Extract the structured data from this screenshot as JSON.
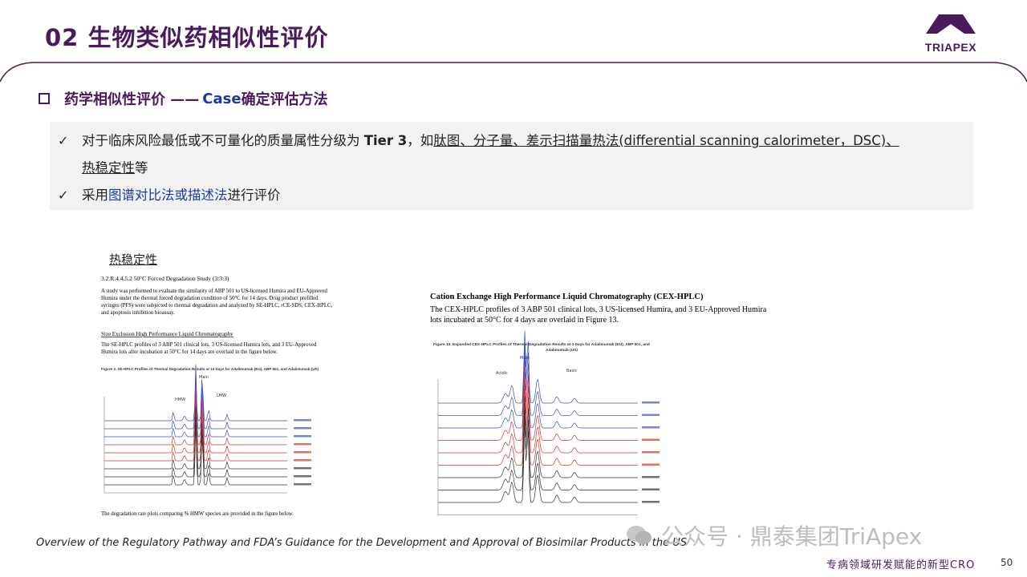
{
  "header": {
    "title": "02 生物类似药相似性评价",
    "logo_text": "TRIAPEX"
  },
  "section": {
    "prefix": "药学相似性评价 —— ",
    "case": "Case",
    "suffix": " 确定评估方法"
  },
  "bullets": {
    "b1_a": "对于临床风险最低或不可量化的质量属性分级为 ",
    "b1_tier": "Tier 3",
    "b1_b": "，如",
    "b1_list": "肽图、分子量、差示扫描量热法(differential scanning calorimeter，DSC)、",
    "b1_line2": "热稳定性",
    "b1_end": "等",
    "b2_a": "采用",
    "b2_blue": "图谱对比法或描述法",
    "b2_end": "进行评价"
  },
  "left_doc": {
    "caption": "热稳定性",
    "heading": "3.2.R.4.4.5.2 50°C Forced Degradation Study (3:3:3)",
    "para1": [
      "A study was performed to evaluate the similarity of ABP 501 to US-licensed Humira and EU-Approved",
      "Humira under the thermal forced degradation condition of 50°C for 14 days.  Drug product prefilled",
      "syringes (PFS) were subjected to thermal degradation and analyzed by SE-HPLC, rCE-SDS, CEX-HPLC,",
      "and apoptosis inhibition bioassay."
    ],
    "subheading": "Size Exclusion High Performance Liquid Chromatography",
    "para2": [
      "The SE-HPLC profiles of 3 ABP 501 clinical lots, 3 US-licensed Humira lots, and 3 EU-Approved",
      "Humira lots after incubation at 50°C for 14 days are overlaid in the figure below."
    ],
    "fig_title": "Figure 3.  SE-HPLC Profiles of Thermal Degradation Results at 14 Days for Adalimumab (EU), ABP 501, and Adalimumab (US)",
    "labels": {
      "hmw": "HMW",
      "main": "Main",
      "lmw": "LMW"
    },
    "bottom": "The degradation rate plots comparing % HMW species are provided in the figure below."
  },
  "right_doc": {
    "heading": "Cation Exchange High Performance Liquid Chromatography (CEX-HPLC)",
    "para": [
      "The CEX-HPLC profiles of 3 ABP 501 clinical lots, 3 US-licensed Humira, and 3 EU-Approved Humira",
      "lots incubated at 50°C for 4 days are overlaid in Figure 13."
    ],
    "fig_title": [
      "Figure 13.  Expanded CEX-HPLC Profiles of Thermal Degradation Results at 4 Days for Adalimumab (EU), ABP 501, and",
      "Adalimumab (US)"
    ],
    "labels": {
      "acidic": "Acidic",
      "main": "Main",
      "basic": "Basic"
    }
  },
  "footer": {
    "source": "Overview of the Regulatory Pathway and FDA’s Guidance for the Development and Approval of Biosimilar Products in the US",
    "watermark": "公众号 · 鼎泰集团TriApex",
    "tagline": "专病领域研发赋能的新型CRO",
    "page": "50"
  },
  "colors": {
    "brand": "#4a1a5c",
    "accent_blue": "#1a3aa0",
    "trace_blue": "#3a4fc8",
    "trace_red": "#d8332a",
    "trace_black": "#333333"
  }
}
